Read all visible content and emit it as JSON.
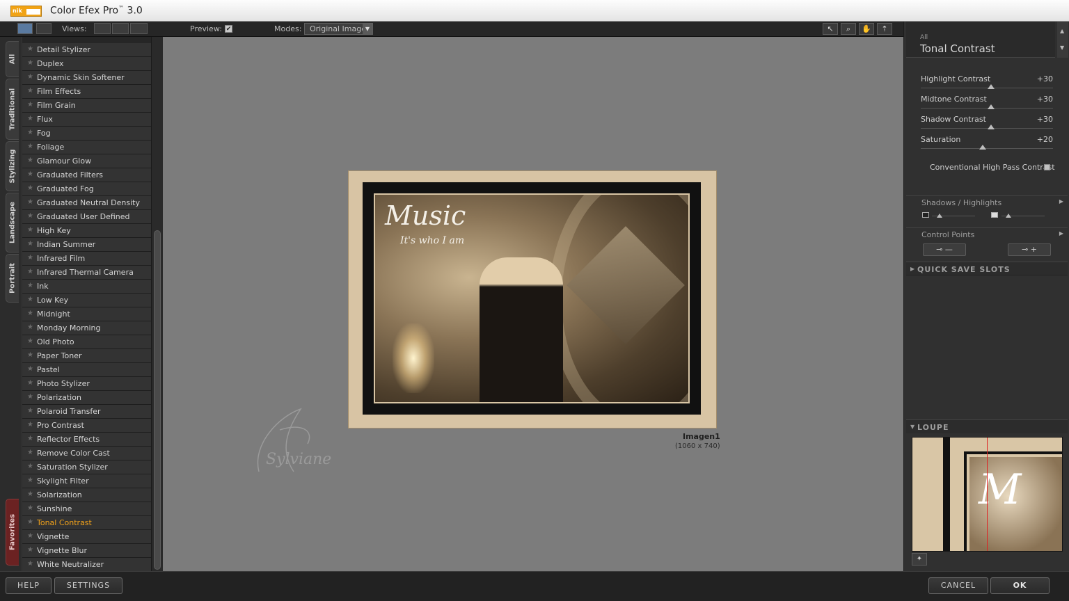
{
  "window": {
    "title": "Color Efex Pro",
    "title_tm": "™",
    "title_version": " 3.0",
    "logo_text": "nik"
  },
  "toolbar": {
    "views_label": "Views:",
    "preview_label": "Preview:",
    "preview_checked": "✔",
    "modes_label": "Modes:",
    "modes_value": "Original Image"
  },
  "left_tabs": [
    "All",
    "Traditional",
    "Stylizing",
    "Landscape",
    "Portrait",
    "Favorites"
  ],
  "filters": [
    "Detail Stylizer",
    "Duplex",
    "Dynamic Skin Softener",
    "Film Effects",
    "Film Grain",
    "Flux",
    "Fog",
    "Foliage",
    "Glamour Glow",
    "Graduated Filters",
    "Graduated Fog",
    "Graduated Neutral Density",
    "Graduated User Defined",
    "High Key",
    "Indian Summer",
    "Infrared Film",
    "Infrared Thermal Camera",
    "Ink",
    "Low Key",
    "Midnight",
    "Monday Morning",
    "Old Photo",
    "Paper Toner",
    "Pastel",
    "Photo Stylizer",
    "Polarization",
    "Polaroid Transfer",
    "Pro Contrast",
    "Reflector Effects",
    "Remove Color Cast",
    "Saturation Stylizer",
    "Skylight Filter",
    "Solarization",
    "Sunshine",
    "Tonal Contrast",
    "Vignette",
    "Vignette Blur",
    "White Neutralizer"
  ],
  "active_filter": "Tonal Contrast",
  "preview": {
    "image_name": "Imagen1",
    "image_size": "(1060 x 740)",
    "art_title": "Music",
    "art_subtitle": "It's who I am",
    "watermark": "Sylviane"
  },
  "panel": {
    "category": "All",
    "filter_name": "Tonal Contrast",
    "sliders": [
      {
        "label": "Highlight Contrast",
        "value": "+30",
        "pos": 0.53
      },
      {
        "label": "Midtone Contrast",
        "value": "+30",
        "pos": 0.53
      },
      {
        "label": "Shadow Contrast",
        "value": "+30",
        "pos": 0.53
      },
      {
        "label": "Saturation",
        "value": "+20",
        "pos": 0.47
      }
    ],
    "conventional_label": "Conventional High Pass Contrast",
    "shadows_highlights_label": "Shadows / Highlights",
    "control_points_label": "Control Points",
    "cp_remove": "—",
    "cp_add": "+",
    "quick_save_label": "QUICK SAVE SLOTS",
    "loupe_label": "LOUPE"
  },
  "bottom": {
    "help": "HELP",
    "settings": "SETTINGS",
    "cancel": "CANCEL",
    "ok": "OK"
  }
}
